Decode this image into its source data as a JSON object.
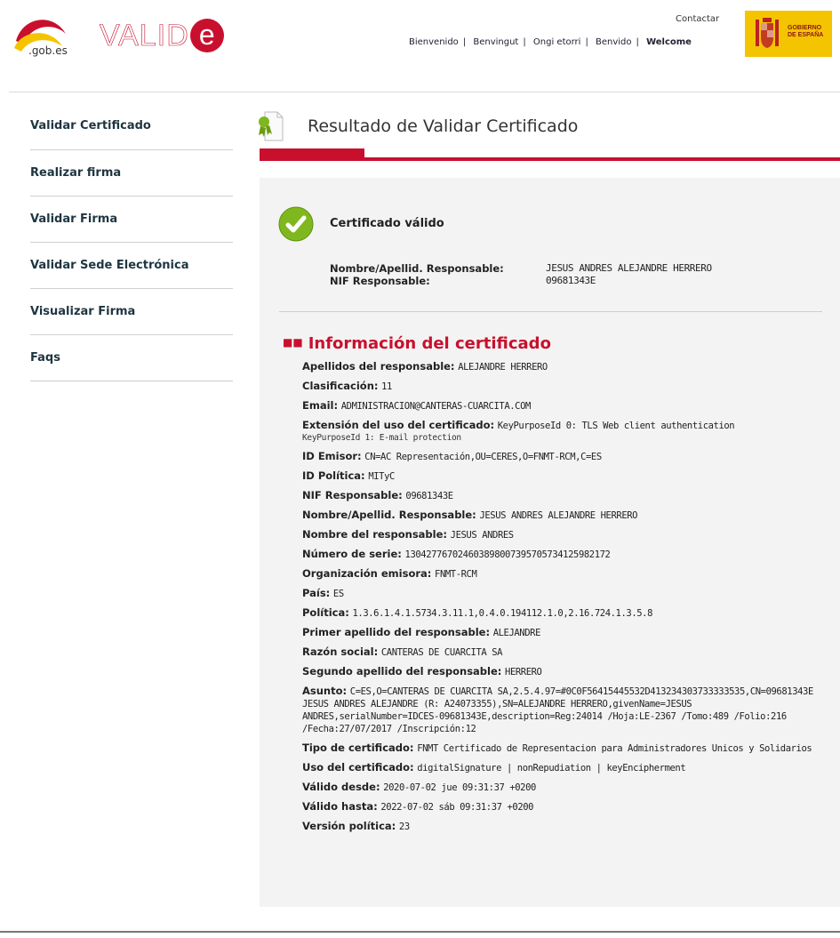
{
  "header": {
    "gob_text": ".gob.es",
    "logo_text": "VALID",
    "logo_e": "e",
    "contact": "Contactar",
    "languages": [
      "Bienvenido",
      "Benvingut",
      "Ongi etorri",
      "Benvido",
      "Welcome"
    ],
    "gov_badge_line1": "GOBIERNO",
    "gov_badge_line2": "DE ESPAÑA"
  },
  "sidebar": {
    "items": [
      {
        "label": "Validar Certificado"
      },
      {
        "label": "Realizar firma"
      },
      {
        "label": "Validar Firma"
      },
      {
        "label": "Validar Sede Electrónica"
      },
      {
        "label": "Visualizar Firma"
      },
      {
        "label": "Faqs"
      }
    ]
  },
  "main": {
    "title": "Resultado de Validar Certificado",
    "status": "Certificado válido",
    "responsable_labels": [
      "Nombre/Apellid. Responsable:",
      "NIF Responsable:"
    ],
    "responsable_values": [
      "JESUS ANDRES ALEJANDRE HERRERO",
      "09681343E"
    ],
    "info_heading": "Información del certificado",
    "fields": [
      {
        "key": "Apellidos del responsable:",
        "value": "ALEJANDRE HERRERO"
      },
      {
        "key": "Clasificación:",
        "value": "11"
      },
      {
        "key": "Email:",
        "value": "ADMINISTRACION@CANTERAS-CUARCITA.COM"
      },
      {
        "key": "Extensión del uso del certificado:",
        "value": "KeyPurposeId 0: TLS Web client authentication",
        "value2": "KeyPurposeId 1: E-mail protection"
      },
      {
        "key": "ID Emisor:",
        "value": "CN=AC Representación,OU=CERES,O=FNMT-RCM,C=ES"
      },
      {
        "key": "ID Política:",
        "value": "MITyC"
      },
      {
        "key": "NIF Responsable:",
        "value": "09681343E"
      },
      {
        "key": "Nombre/Apellid. Responsable:",
        "value": "JESUS ANDRES ALEJANDRE HERRERO"
      },
      {
        "key": "Nombre del responsable:",
        "value": "JESUS ANDRES"
      },
      {
        "key": "Número de serie:",
        "value": "130427767024603898007395705734125982172"
      },
      {
        "key": "Organización emisora:",
        "value": "FNMT-RCM"
      },
      {
        "key": "País:",
        "value": "ES"
      },
      {
        "key": "Política:",
        "value": "1.3.6.1.4.1.5734.3.11.1,0.4.0.194112.1.0,2.16.724.1.3.5.8"
      },
      {
        "key": "Primer apellido del responsable:",
        "value": "ALEJANDRE"
      },
      {
        "key": "Razón social:",
        "value": "CANTERAS DE CUARCITA SA"
      },
      {
        "key": "Segundo apellido del responsable:",
        "value": "HERRERO"
      },
      {
        "key": "Asunto:",
        "value": "C=ES,O=CANTERAS DE CUARCITA SA,2.5.4.97=#0C0F56415445532D413234303733333535,CN=09681343E JESUS ANDRES ALEJANDRE (R: A24073355),SN=ALEJANDRE HERRERO,givenName=JESUS ANDRES,serialNumber=IDCES-09681343E,description=Reg:24014 /Hoja:LE-2367 /Tomo:489 /Folio:216 /Fecha:27/07/2017 /Inscripción:12"
      },
      {
        "key": "Tipo de certificado:",
        "value": "FNMT Certificado de Representacion para Administradores Unicos y Solidarios"
      },
      {
        "key": "Uso del certificado:",
        "value": "digitalSignature | nonRepudiation | keyEncipherment"
      },
      {
        "key": "Válido desde:",
        "value": "2020-07-02 jue 09:31:37 +0200"
      },
      {
        "key": "Válido hasta:",
        "value": "2022-07-02 sáb 09:31:37 +0200"
      },
      {
        "key": "Versión política:",
        "value": "23"
      }
    ]
  },
  "colors": {
    "brand_red": "#c8102e",
    "gov_yellow": "#f5c400",
    "valid_green": "#7fb81e",
    "content_bg": "#f3f3f3"
  }
}
